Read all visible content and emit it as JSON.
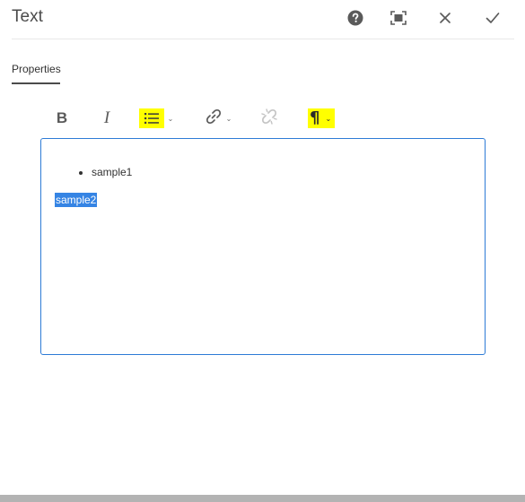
{
  "dialog": {
    "title": "Text",
    "actions": {
      "help_icon": "question-circle-icon",
      "fullscreen_icon": "fullscreen-icon",
      "close_icon": "close-icon",
      "confirm_icon": "checkmark-icon"
    }
  },
  "tabs": [
    {
      "label": "Properties",
      "active": true
    }
  ],
  "toolbar": {
    "bold_label": "B",
    "italic_label": "I",
    "list_icon": "bulleted-list-icon",
    "link_icon": "link-icon",
    "unlink_icon": "unlink-icon",
    "paragraph_label": "¶",
    "highlight_color": "#ffff00"
  },
  "editor": {
    "list_items": [
      "sample1"
    ],
    "selected_paragraph": "sample2",
    "border_color": "#2d7bd6",
    "selection_color": "#3584e4"
  }
}
